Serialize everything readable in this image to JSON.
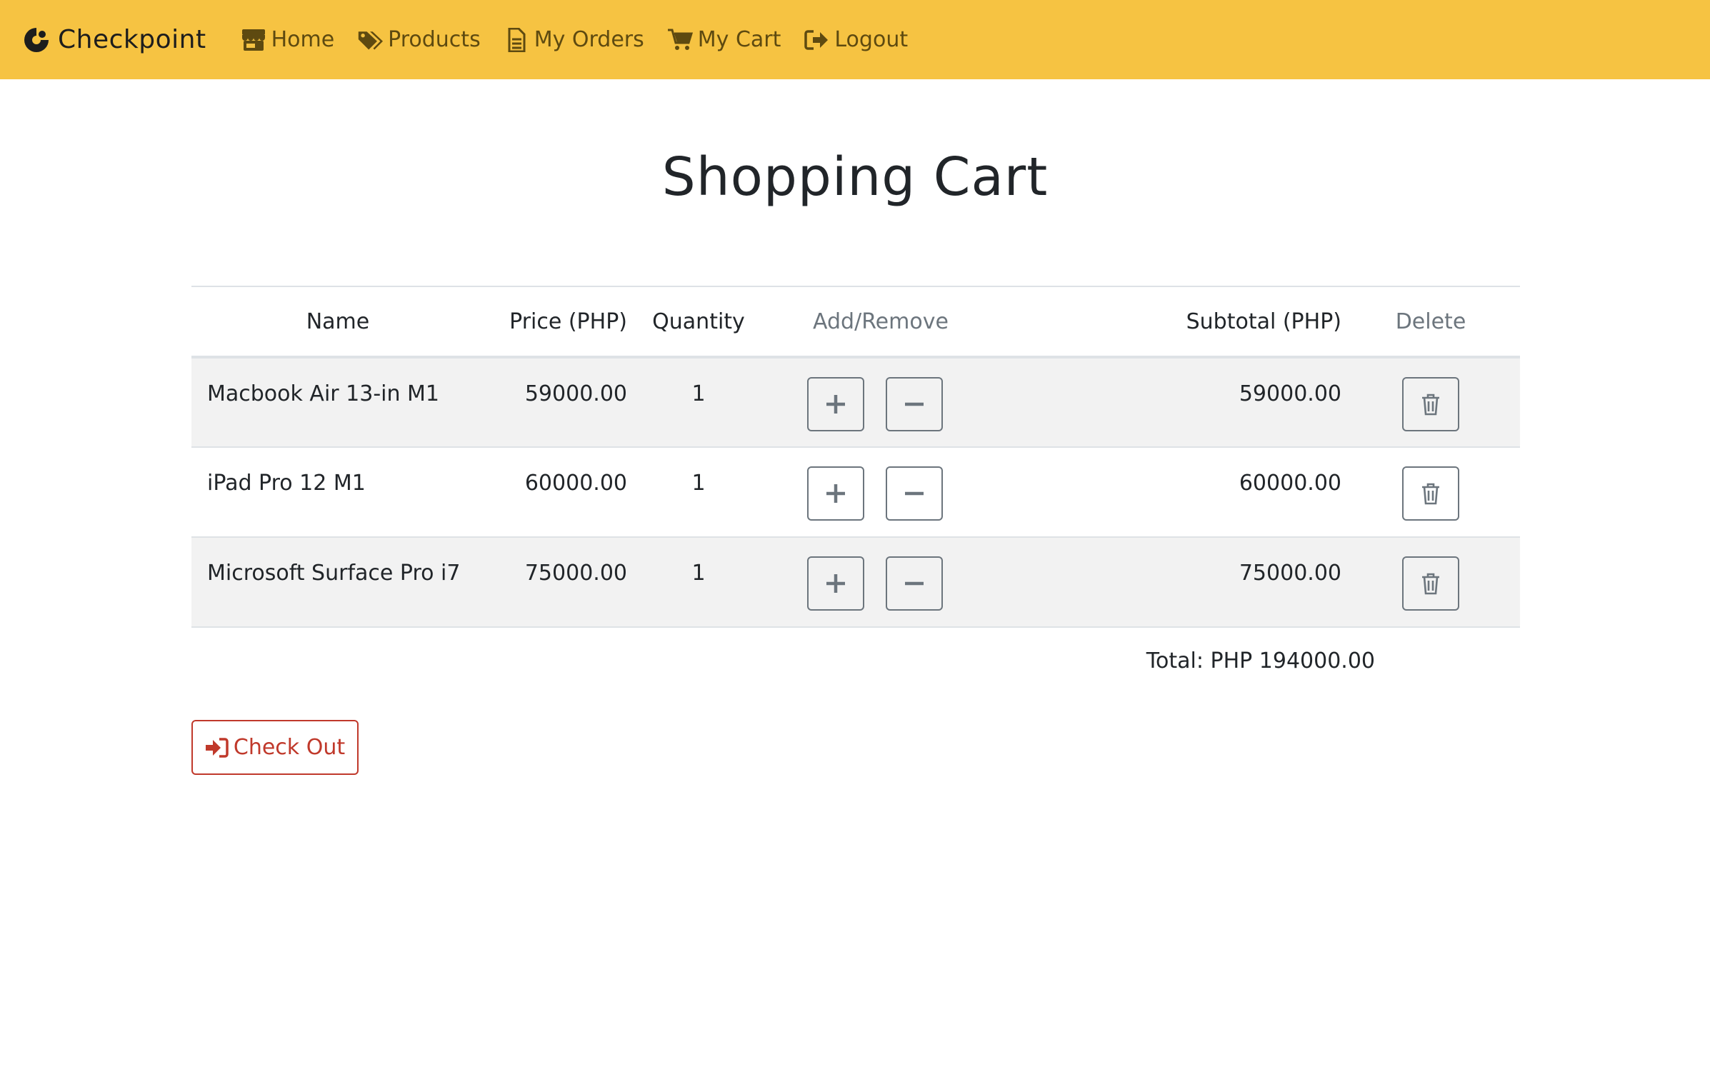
{
  "brand": {
    "name": "Checkpoint",
    "icon": "checkpoint-logo-icon"
  },
  "nav": {
    "items": [
      {
        "label": "Home",
        "icon": "store-icon"
      },
      {
        "label": "Products",
        "icon": "tags-icon"
      },
      {
        "label": "My Orders",
        "icon": "file-icon"
      },
      {
        "label": "My Cart",
        "icon": "cart-icon"
      },
      {
        "label": "Logout",
        "icon": "sign-out-icon"
      }
    ]
  },
  "page": {
    "title": "Shopping Cart"
  },
  "table": {
    "headers": {
      "name": "Name",
      "price": "Price (PHP)",
      "quantity": "Quantity",
      "add_remove": "Add/Remove",
      "subtotal": "Subtotal (PHP)",
      "delete": "Delete"
    },
    "rows": [
      {
        "name": "Macbook Air 13-in M1",
        "price": "59000.00",
        "quantity": "1",
        "subtotal": "59000.00"
      },
      {
        "name": "iPad Pro 12 M1",
        "price": "60000.00",
        "quantity": "1",
        "subtotal": "60000.00"
      },
      {
        "name": "Microsoft Surface Pro i7",
        "price": "75000.00",
        "quantity": "1",
        "subtotal": "75000.00"
      }
    ]
  },
  "total": {
    "label": "Total: PHP 194000.00"
  },
  "checkout": {
    "label": "Check Out",
    "icon": "sign-in-icon"
  },
  "colors": {
    "navbar_bg": "#f6c342",
    "nav_text": "#5e4a10",
    "row_stripe": "#f2f2f2",
    "danger": "#c0392b",
    "secondary": "#6c757d"
  }
}
